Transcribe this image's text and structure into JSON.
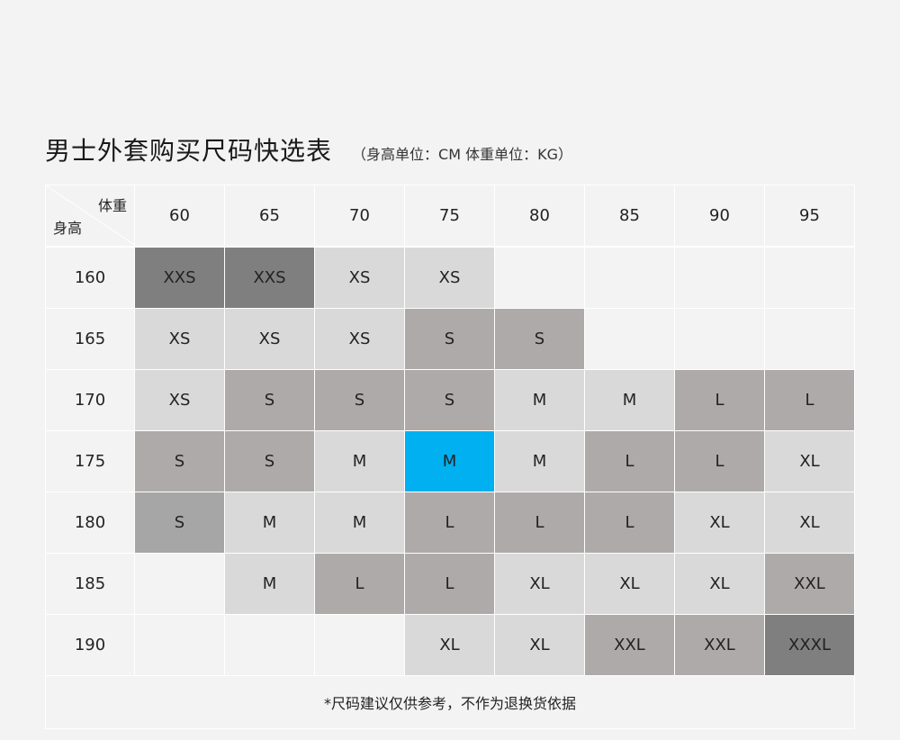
{
  "title": "男士外套购买尺码快选表",
  "subtitle": "（身高单位：CM 体重单位：KG）",
  "corner": {
    "weight_label": "体重",
    "height_label": "身高"
  },
  "weights": [
    "60",
    "65",
    "70",
    "75",
    "80",
    "85",
    "90",
    "95"
  ],
  "rows": [
    {
      "height": "160",
      "sizes": [
        "XXS",
        "XXS",
        "XS",
        "XS",
        "",
        "",
        "",
        ""
      ]
    },
    {
      "height": "165",
      "sizes": [
        "XS",
        "XS",
        "XS",
        "S",
        "S",
        "",
        "",
        ""
      ]
    },
    {
      "height": "170",
      "sizes": [
        "XS",
        "S",
        "S",
        "S",
        "M",
        "M",
        "L",
        "L"
      ]
    },
    {
      "height": "175",
      "sizes": [
        "S",
        "S",
        "M",
        "M",
        "M",
        "L",
        "L",
        "XL"
      ]
    },
    {
      "height": "180",
      "sizes": [
        "S",
        "M",
        "M",
        "L",
        "L",
        "L",
        "XL",
        "XL"
      ]
    },
    {
      "height": "185",
      "sizes": [
        "",
        "M",
        "L",
        "L",
        "XL",
        "XL",
        "XL",
        "XXL"
      ]
    },
    {
      "height": "190",
      "sizes": [
        "",
        "",
        "",
        "XL",
        "XL",
        "XXL",
        "XXL",
        "XXXL"
      ]
    }
  ],
  "cell_colors": [
    [
      "#7f7f7f",
      "#7f7f7f",
      "#d9d9d9",
      "#d9d9d9",
      "#f3f3f3",
      "#f3f3f3",
      "#f3f3f3",
      "#f3f3f3"
    ],
    [
      "#d9d9d9",
      "#d9d9d9",
      "#d9d9d9",
      "#aeaaaa",
      "#aeaaaa",
      "#f3f3f3",
      "#f3f3f3",
      "#f3f3f3"
    ],
    [
      "#d9d9d9",
      "#aeaaaa",
      "#aeaaaa",
      "#aeaaaa",
      "#d9d9d9",
      "#d9d9d9",
      "#aeaaaa",
      "#aeaaaa"
    ],
    [
      "#aeaaaa",
      "#aeaaaa",
      "#d9d9d9",
      "#00b0f0",
      "#d9d9d9",
      "#aeaaaa",
      "#aeaaaa",
      "#d9d9d9"
    ],
    [
      "#a6a6a6",
      "#d9d9d9",
      "#d9d9d9",
      "#aeaaaa",
      "#aeaaaa",
      "#aeaaaa",
      "#d9d9d9",
      "#d9d9d9"
    ],
    [
      "#f3f3f3",
      "#d9d9d9",
      "#aeaaaa",
      "#aeaaaa",
      "#d9d9d9",
      "#d9d9d9",
      "#d9d9d9",
      "#aeaaaa"
    ],
    [
      "#f3f3f3",
      "#f3f3f3",
      "#f3f3f3",
      "#d9d9d9",
      "#d9d9d9",
      "#aeaaaa",
      "#aeaaaa",
      "#7f7f7f"
    ]
  ],
  "footnote": "*尺码建议仅供参考，不作为退换货依据"
}
